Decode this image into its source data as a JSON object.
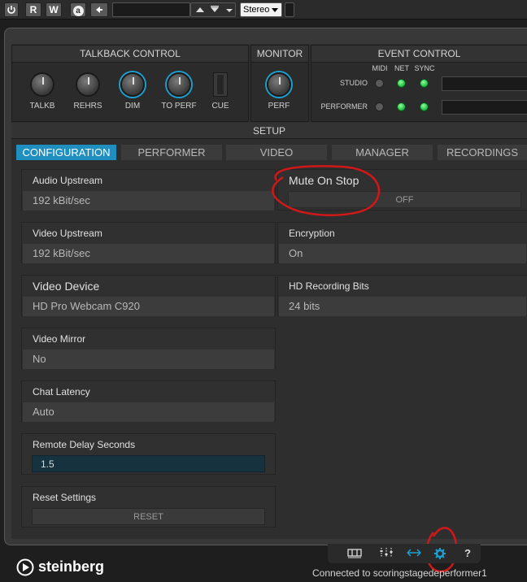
{
  "toolbar": {
    "power_icon": "power-icon",
    "read_label": "R",
    "write_label": "W",
    "auto_label": "a",
    "back_icon": "arrow-left-icon",
    "channel_value": "",
    "format_label": "Stereo"
  },
  "talkback": {
    "title": "TALKBACK CONTROL",
    "knobs": [
      {
        "label": "TALKB"
      },
      {
        "label": "REHRS"
      },
      {
        "label": "DIM"
      },
      {
        "label": "TO PERF"
      }
    ],
    "cue_label": "CUE"
  },
  "monitor": {
    "title": "MONITOR",
    "knob_label": "PERF"
  },
  "event_control": {
    "title": "EVENT CONTROL",
    "columns": [
      "MIDI",
      "NET",
      "SYNC"
    ],
    "rows": [
      {
        "label": "STUDIO",
        "states": [
          "off",
          "on",
          "on"
        ]
      },
      {
        "label": "PERFORMER",
        "states": [
          "off",
          "on",
          "on"
        ]
      }
    ]
  },
  "setup": {
    "title": "SETUP",
    "tabs": [
      "CONFIGURATION",
      "PERFORMER",
      "VIDEO",
      "MANAGER",
      "RECORDINGS"
    ],
    "active_tab": "CONFIGURATION"
  },
  "config": {
    "audio_upstream": {
      "label": "Audio Upstream",
      "value": "192 kBit/sec"
    },
    "mute_on_stop": {
      "label": "Mute On Stop",
      "value": "OFF"
    },
    "video_upstream": {
      "label": "Video Upstream",
      "value": "192 kBit/sec"
    },
    "encryption": {
      "label": "Encryption",
      "value": "On"
    },
    "video_device": {
      "label": "Video Device",
      "value": "HD Pro Webcam C920"
    },
    "hd_recording_bits": {
      "label": "HD Recording Bits",
      "value": "24 bits"
    },
    "video_mirror": {
      "label": "Video Mirror",
      "value": "No"
    },
    "chat_latency": {
      "label": "Chat Latency",
      "value": "Auto"
    },
    "remote_delay": {
      "label": "Remote Delay Seconds",
      "value": "1.5"
    },
    "reset_settings": {
      "label": "Reset Settings",
      "button": "RESET"
    }
  },
  "footer": {
    "brand": "steinberg",
    "status": "Connected to scoringstagedeperformer1",
    "icons": [
      "routing-icon",
      "mixer-icon",
      "video-link-icon",
      "settings-icon",
      "help-icon"
    ],
    "help_label": "?"
  },
  "colors": {
    "accent": "#1f8fc0",
    "led_on": "#19b83a",
    "annotation": "#d01818"
  }
}
